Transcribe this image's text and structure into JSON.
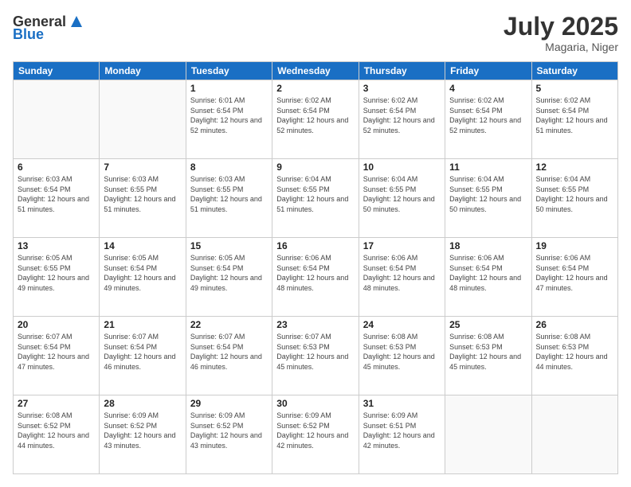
{
  "header": {
    "logo_general": "General",
    "logo_blue": "Blue",
    "title": "July 2025",
    "location": "Magaria, Niger"
  },
  "weekdays": [
    "Sunday",
    "Monday",
    "Tuesday",
    "Wednesday",
    "Thursday",
    "Friday",
    "Saturday"
  ],
  "weeks": [
    [
      {
        "day": "",
        "info": ""
      },
      {
        "day": "",
        "info": ""
      },
      {
        "day": "1",
        "info": "Sunrise: 6:01 AM\nSunset: 6:54 PM\nDaylight: 12 hours and 52 minutes."
      },
      {
        "day": "2",
        "info": "Sunrise: 6:02 AM\nSunset: 6:54 PM\nDaylight: 12 hours and 52 minutes."
      },
      {
        "day": "3",
        "info": "Sunrise: 6:02 AM\nSunset: 6:54 PM\nDaylight: 12 hours and 52 minutes."
      },
      {
        "day": "4",
        "info": "Sunrise: 6:02 AM\nSunset: 6:54 PM\nDaylight: 12 hours and 52 minutes."
      },
      {
        "day": "5",
        "info": "Sunrise: 6:02 AM\nSunset: 6:54 PM\nDaylight: 12 hours and 51 minutes."
      }
    ],
    [
      {
        "day": "6",
        "info": "Sunrise: 6:03 AM\nSunset: 6:54 PM\nDaylight: 12 hours and 51 minutes."
      },
      {
        "day": "7",
        "info": "Sunrise: 6:03 AM\nSunset: 6:55 PM\nDaylight: 12 hours and 51 minutes."
      },
      {
        "day": "8",
        "info": "Sunrise: 6:03 AM\nSunset: 6:55 PM\nDaylight: 12 hours and 51 minutes."
      },
      {
        "day": "9",
        "info": "Sunrise: 6:04 AM\nSunset: 6:55 PM\nDaylight: 12 hours and 51 minutes."
      },
      {
        "day": "10",
        "info": "Sunrise: 6:04 AM\nSunset: 6:55 PM\nDaylight: 12 hours and 50 minutes."
      },
      {
        "day": "11",
        "info": "Sunrise: 6:04 AM\nSunset: 6:55 PM\nDaylight: 12 hours and 50 minutes."
      },
      {
        "day": "12",
        "info": "Sunrise: 6:04 AM\nSunset: 6:55 PM\nDaylight: 12 hours and 50 minutes."
      }
    ],
    [
      {
        "day": "13",
        "info": "Sunrise: 6:05 AM\nSunset: 6:55 PM\nDaylight: 12 hours and 49 minutes."
      },
      {
        "day": "14",
        "info": "Sunrise: 6:05 AM\nSunset: 6:54 PM\nDaylight: 12 hours and 49 minutes."
      },
      {
        "day": "15",
        "info": "Sunrise: 6:05 AM\nSunset: 6:54 PM\nDaylight: 12 hours and 49 minutes."
      },
      {
        "day": "16",
        "info": "Sunrise: 6:06 AM\nSunset: 6:54 PM\nDaylight: 12 hours and 48 minutes."
      },
      {
        "day": "17",
        "info": "Sunrise: 6:06 AM\nSunset: 6:54 PM\nDaylight: 12 hours and 48 minutes."
      },
      {
        "day": "18",
        "info": "Sunrise: 6:06 AM\nSunset: 6:54 PM\nDaylight: 12 hours and 48 minutes."
      },
      {
        "day": "19",
        "info": "Sunrise: 6:06 AM\nSunset: 6:54 PM\nDaylight: 12 hours and 47 minutes."
      }
    ],
    [
      {
        "day": "20",
        "info": "Sunrise: 6:07 AM\nSunset: 6:54 PM\nDaylight: 12 hours and 47 minutes."
      },
      {
        "day": "21",
        "info": "Sunrise: 6:07 AM\nSunset: 6:54 PM\nDaylight: 12 hours and 46 minutes."
      },
      {
        "day": "22",
        "info": "Sunrise: 6:07 AM\nSunset: 6:54 PM\nDaylight: 12 hours and 46 minutes."
      },
      {
        "day": "23",
        "info": "Sunrise: 6:07 AM\nSunset: 6:53 PM\nDaylight: 12 hours and 45 minutes."
      },
      {
        "day": "24",
        "info": "Sunrise: 6:08 AM\nSunset: 6:53 PM\nDaylight: 12 hours and 45 minutes."
      },
      {
        "day": "25",
        "info": "Sunrise: 6:08 AM\nSunset: 6:53 PM\nDaylight: 12 hours and 45 minutes."
      },
      {
        "day": "26",
        "info": "Sunrise: 6:08 AM\nSunset: 6:53 PM\nDaylight: 12 hours and 44 minutes."
      }
    ],
    [
      {
        "day": "27",
        "info": "Sunrise: 6:08 AM\nSunset: 6:52 PM\nDaylight: 12 hours and 44 minutes."
      },
      {
        "day": "28",
        "info": "Sunrise: 6:09 AM\nSunset: 6:52 PM\nDaylight: 12 hours and 43 minutes."
      },
      {
        "day": "29",
        "info": "Sunrise: 6:09 AM\nSunset: 6:52 PM\nDaylight: 12 hours and 43 minutes."
      },
      {
        "day": "30",
        "info": "Sunrise: 6:09 AM\nSunset: 6:52 PM\nDaylight: 12 hours and 42 minutes."
      },
      {
        "day": "31",
        "info": "Sunrise: 6:09 AM\nSunset: 6:51 PM\nDaylight: 12 hours and 42 minutes."
      },
      {
        "day": "",
        "info": ""
      },
      {
        "day": "",
        "info": ""
      }
    ]
  ]
}
